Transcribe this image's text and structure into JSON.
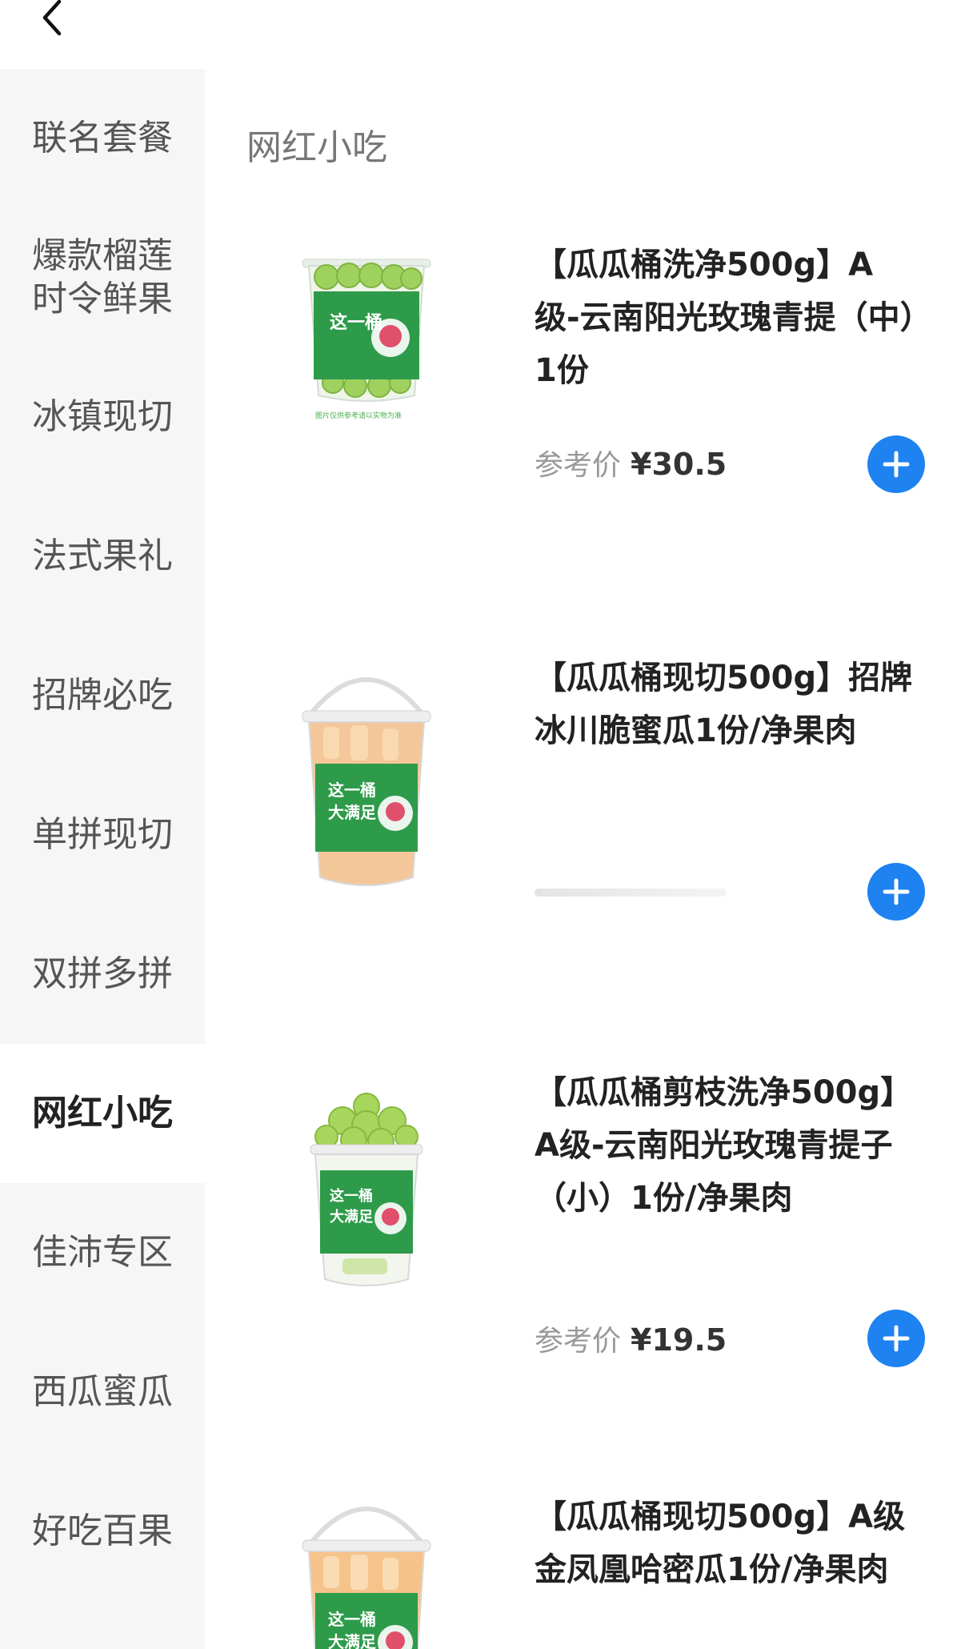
{
  "header": {
    "back_icon": "chevron-left-icon"
  },
  "sidebar": {
    "items": [
      {
        "label": "联名套餐",
        "active": false
      },
      {
        "label": "爆款榴莲\n时令鲜果",
        "active": false
      },
      {
        "label": "冰镇现切",
        "active": false
      },
      {
        "label": "法式果礼",
        "active": false
      },
      {
        "label": "招牌必吃",
        "active": false
      },
      {
        "label": "单拼现切",
        "active": false
      },
      {
        "label": "双拼多拼",
        "active": false
      },
      {
        "label": "网红小吃",
        "active": true
      },
      {
        "label": "佳沛专区",
        "active": false
      },
      {
        "label": "西瓜蜜瓜",
        "active": false
      },
      {
        "label": "好吃百果",
        "active": false
      }
    ]
  },
  "section": {
    "title": "网红小吃"
  },
  "products": [
    {
      "name": "【瓜瓜桶洗净500g】A级-云南阳光玫瑰青提（中）1份",
      "price_label": "参考价",
      "price": "¥30.5",
      "image_icon": "green-grape-bucket-image"
    },
    {
      "name": "【瓜瓜桶现切500g】招牌冰川脆蜜瓜1份/净果肉",
      "price_label": "",
      "price": "",
      "image_icon": "melon-bucket-image"
    },
    {
      "name": "【瓜瓜桶剪枝洗净500g】A级-云南阳光玫瑰青提子（小）1份/净果肉",
      "price_label": "参考价",
      "price": "¥19.5",
      "image_icon": "grape-cup-image"
    },
    {
      "name": "【瓜瓜桶现切500g】A级金凤凰哈密瓜1份/净果肉",
      "price_label": "",
      "price": "",
      "image_icon": "hami-melon-bucket-image"
    }
  ],
  "colors": {
    "accent": "#1e82f0",
    "sidebar_bg": "#f6f6f6",
    "brand_green": "#2e9b4a"
  }
}
